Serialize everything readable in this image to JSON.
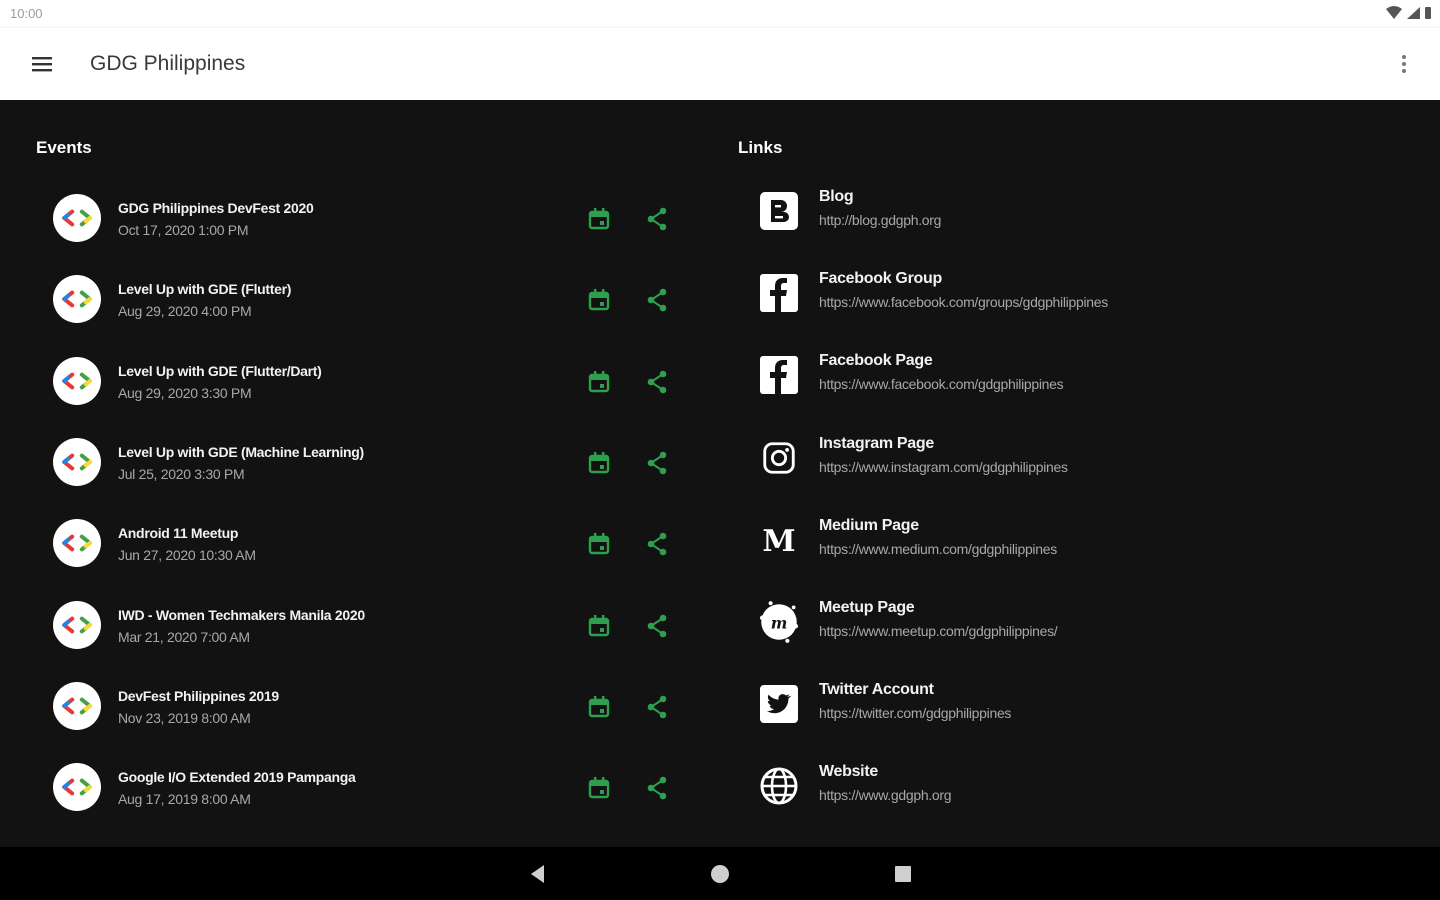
{
  "status_bar": {
    "time": "10:00"
  },
  "app_bar": {
    "title": "GDG Philippines"
  },
  "events": {
    "title": "Events",
    "items": [
      {
        "name": "GDG Philippines DevFest 2020",
        "date": "Oct 17, 2020 1:00 PM"
      },
      {
        "name": "Level Up with GDE (Flutter)",
        "date": "Aug 29, 2020 4:00 PM"
      },
      {
        "name": "Level Up with GDE (Flutter/Dart)",
        "date": "Aug 29, 2020 3:30 PM"
      },
      {
        "name": "Level Up with GDE (Machine Learning)",
        "date": "Jul 25, 2020 3:30 PM"
      },
      {
        "name": "Android 11 Meetup",
        "date": "Jun 27, 2020 10:30 AM"
      },
      {
        "name": "IWD - Women Techmakers Manila 2020",
        "date": "Mar 21, 2020 7:00 AM"
      },
      {
        "name": "DevFest Philippines 2019",
        "date": "Nov 23, 2019 8:00 AM"
      },
      {
        "name": "Google I/O Extended 2019 Pampanga",
        "date": "Aug 17, 2019 8:00 AM"
      }
    ]
  },
  "links": {
    "title": "Links",
    "items": [
      {
        "name": "Blog",
        "url": "http://blog.gdgph.org",
        "icon": "blogger-icon"
      },
      {
        "name": "Facebook Group",
        "url": "https://www.facebook.com/groups/gdgphilippines",
        "icon": "facebook-icon"
      },
      {
        "name": "Facebook Page",
        "url": "https://www.facebook.com/gdgphilippines",
        "icon": "facebook-icon"
      },
      {
        "name": "Instagram Page",
        "url": "https://www.instagram.com/gdgphilippines",
        "icon": "instagram-icon"
      },
      {
        "name": "Medium Page",
        "url": "https://www.medium.com/gdgphilippines",
        "icon": "medium-icon"
      },
      {
        "name": "Meetup Page",
        "url": "https://www.meetup.com/gdgphilippines/",
        "icon": "meetup-icon"
      },
      {
        "name": "Twitter Account",
        "url": "https://twitter.com/gdgphilippines",
        "icon": "twitter-icon"
      },
      {
        "name": "Website",
        "url": "https://www.gdgph.org",
        "icon": "globe-icon"
      }
    ]
  },
  "colors": {
    "accent_green": "#2e9e4f",
    "background": "#121212",
    "app_bar": "#ffffff"
  }
}
